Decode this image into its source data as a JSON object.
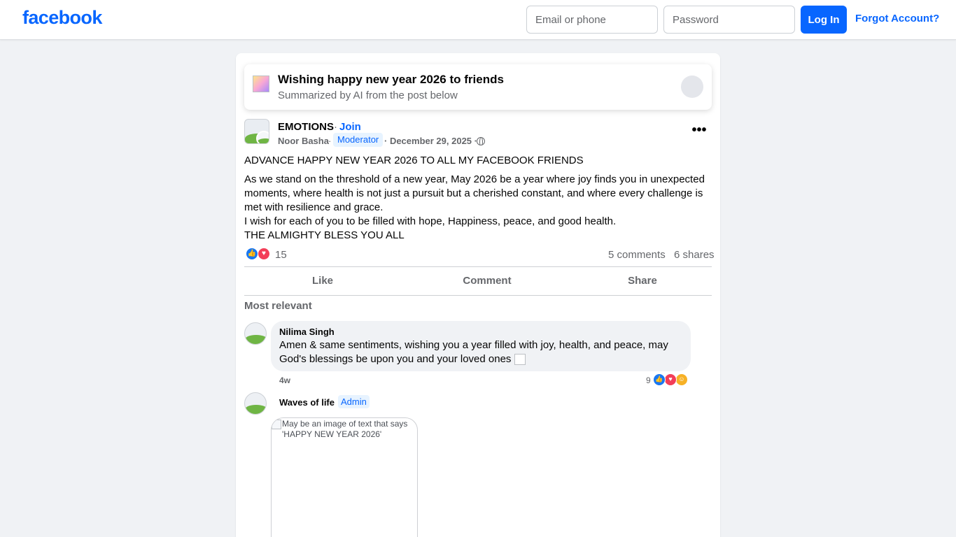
{
  "header": {
    "logo": "facebook",
    "email_placeholder": "Email or phone",
    "password_placeholder": "Password",
    "login_label": "Log In",
    "forgot_label": "Forgot Account?"
  },
  "ai_summary": {
    "title": "Wishing happy new year 2026 to friends",
    "subtitle": "Summarized by AI from the post below"
  },
  "post": {
    "group_name": "EMOTIONS",
    "separator": "·",
    "join_label": "Join",
    "author": "Noor Basha",
    "role": "Moderator",
    "date": "· December 29, 2025 ·",
    "more_label": "•••",
    "headline": "ADVANCE HAPPY NEW YEAR 2026 TO ALL MY FACEBOOK  FRIENDS",
    "body_1": "As we stand on the threshold of a new year,  May 2026 be a year where joy finds you in unexpected moments, where health is not just a pursuit but a cherished constant, and where every challenge is met with resilience and grace.",
    "body_2": "I wish for each of you to be filled with hope, Happiness, peace, and good health.",
    "body_3": "THE ALMIGHTY BLESS YOU ALL",
    "reaction_count": "15",
    "comments": "5 comments",
    "shares": "6 shares"
  },
  "actions": {
    "like": "Like",
    "comment": "Comment",
    "share": "Share"
  },
  "comments_section": {
    "sort_label": "Most relevant",
    "items": [
      {
        "name": "Nilima Singh",
        "text": "Amen & same sentiments, wishing you a year filled with joy, health, and peace, may God's blessings be upon you and your loved ones",
        "time": "4w",
        "reaction_count": "9"
      },
      {
        "name": "Waves of life",
        "role": "Admin",
        "image_alt": "May be an image of text that says 'HAPPY NEW YEAR 2026'"
      }
    ]
  },
  "icons": {
    "like": "like-icon",
    "love": "heart-icon",
    "care": "care-icon",
    "globe": "globe-icon"
  },
  "colors": {
    "brand": "#0866ff",
    "like": "#1877f2",
    "love": "#f33e58",
    "care": "#f7b125"
  }
}
